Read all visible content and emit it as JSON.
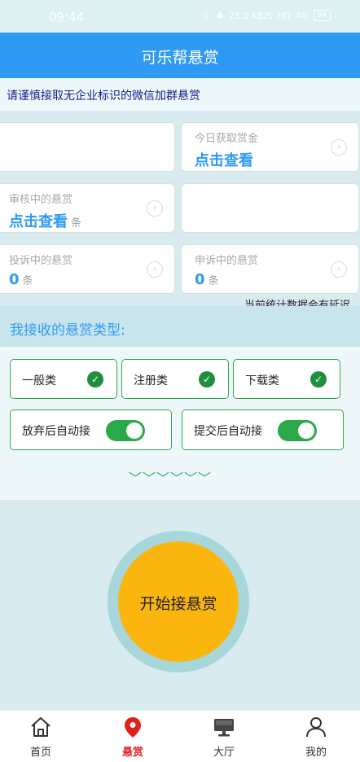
{
  "status_bar": {
    "time": "09:44",
    "net": "25.0 KB/S",
    "hd": "HD",
    "signal": "4G",
    "battery": "84"
  },
  "header": {
    "title": "可乐帮悬赏"
  },
  "notice": {
    "text": "请谨慎接取无企业标识的微信加群悬赏"
  },
  "stats": {
    "today": {
      "label": "今日获取赏金",
      "value": "点击查看"
    },
    "reviewing": {
      "label": "审核中的悬赏",
      "value": "点击查看",
      "unit": "条"
    },
    "complaining": {
      "label": "投诉中的悬赏",
      "value": "0",
      "unit": "条"
    },
    "appealing": {
      "label": "申诉中的悬赏",
      "value": "0",
      "unit": "条"
    },
    "delay_note": "当前统计数据会有延迟",
    "arrow": "›"
  },
  "types": {
    "title": "我接收的悬赏类型:",
    "items": [
      {
        "label": "一般类",
        "checked": true
      },
      {
        "label": "注册类",
        "checked": true
      },
      {
        "label": "下载类",
        "checked": true
      }
    ],
    "toggles": [
      {
        "label": "放弃后自动接",
        "on": true
      },
      {
        "label": "提交后自动接",
        "on": true
      }
    ],
    "check_mark": "✓",
    "expand": "﹀﹀﹀﹀﹀﹀"
  },
  "start": {
    "label": "开始接悬赏"
  },
  "tabs": [
    {
      "label": "首页",
      "icon": "home-icon",
      "active": false
    },
    {
      "label": "悬赏",
      "icon": "location-pin-icon",
      "active": true
    },
    {
      "label": "大厅",
      "icon": "monitor-icon",
      "active": false
    },
    {
      "label": "我的",
      "icon": "user-icon",
      "active": false
    }
  ],
  "colors": {
    "primary": "#2f9af3",
    "green": "#2aa94a",
    "start": "#fbb50f",
    "active_tab": "#e01f1f"
  }
}
